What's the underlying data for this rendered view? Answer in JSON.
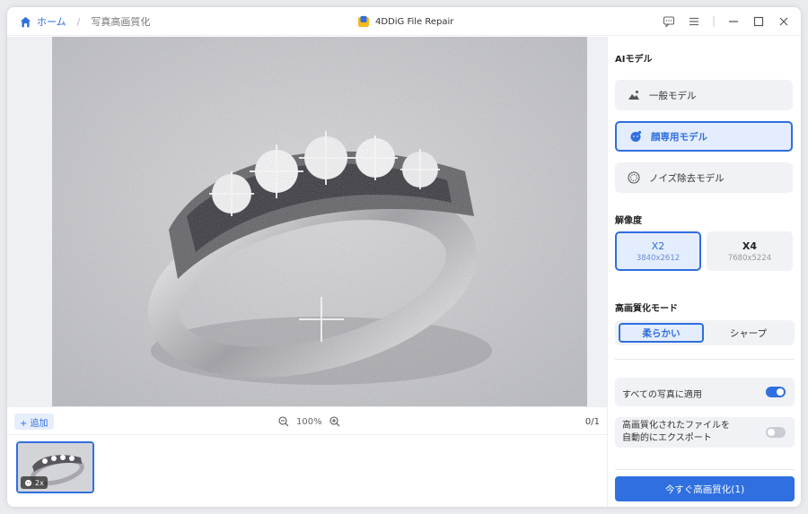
{
  "breadcrumb": {
    "home": "ホーム",
    "separator": "/",
    "current": "写真高画質化"
  },
  "app": {
    "title": "4DDiG File Repair"
  },
  "window_controls": [
    "feedback-icon",
    "menu-icon",
    "minimize-icon",
    "maximize-icon",
    "close-icon"
  ],
  "toolbar": {
    "add_label": "+ 追加",
    "zoom_level": "100%",
    "page_count": "0/1"
  },
  "thumbnail": {
    "badge": "2x"
  },
  "panel": {
    "ai_model_title": "AIモデル",
    "models": [
      {
        "label": "一般モデル",
        "icon": "landscape-icon",
        "active": false
      },
      {
        "label": "顔専用モデル",
        "icon": "face-icon",
        "active": true
      },
      {
        "label": "ノイズ除去モデル",
        "icon": "noise-icon",
        "active": false
      }
    ],
    "resolution_title": "解像度",
    "resolutions": [
      {
        "label": "X2",
        "size": "3840x2612",
        "active": true
      },
      {
        "label": "X4",
        "size": "7680x5224",
        "active": false
      }
    ],
    "mode_title": "高画質化モード",
    "modes": [
      {
        "label": "柔らかい",
        "active": true
      },
      {
        "label": "シャープ",
        "active": false
      }
    ],
    "apply_all": {
      "label": "すべての写真に適用",
      "on": true
    },
    "auto_export": {
      "label_line1": "高画質化されたファイルを",
      "label_line2": "自動的にエクスポート",
      "on": false
    },
    "enhance_button": "今すぐ高画質化(1)"
  },
  "colors": {
    "accent": "#2f6fe0",
    "panel_bg": "#f1f2f5"
  }
}
